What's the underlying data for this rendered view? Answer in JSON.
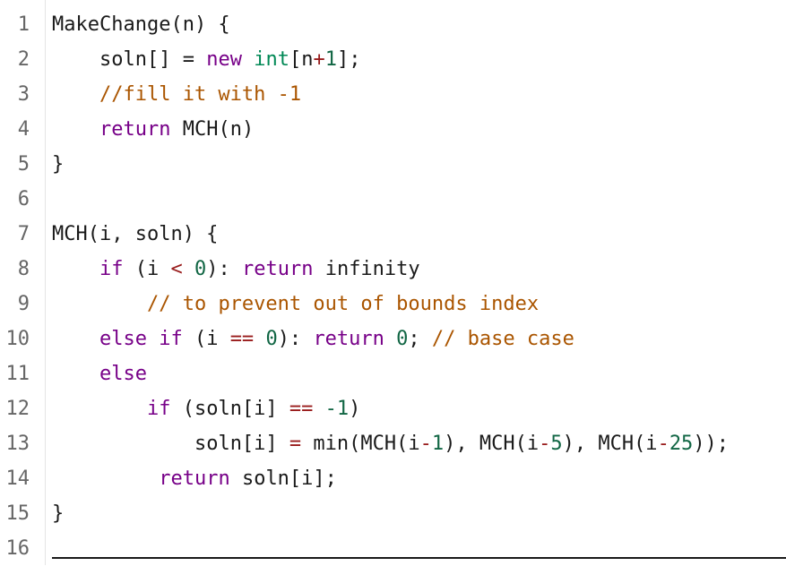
{
  "line_numbers": [
    "1",
    "2",
    "3",
    "4",
    "5",
    "6",
    "7",
    "8",
    "9",
    "10",
    "11",
    "12",
    "13",
    "14",
    "15",
    "16"
  ],
  "code": {
    "l1": {
      "name": "MakeChange(n) {"
    },
    "l2": {
      "a": "soln[] = ",
      "kw": "new",
      "sp": " ",
      "ty": "int",
      "b": "[n",
      "op": "+",
      "n1": "1",
      "c": "];"
    },
    "l3": {
      "cm": "//fill it with -1"
    },
    "l4": {
      "kw": "return",
      "rest": " MCH(n)"
    },
    "l5": {
      "t": "}"
    },
    "l7": {
      "t": "MCH(i, soln) {"
    },
    "l8": {
      "kw1": "if",
      "a": " (i ",
      "op": "<",
      "sp": " ",
      "n0": "0",
      "b": "): ",
      "kw2": "return",
      "c": " infinity"
    },
    "l9": {
      "cm": "// to prevent out of bounds index"
    },
    "l10": {
      "kw1": "else if",
      "a": " (i ",
      "op": "==",
      "sp": " ",
      "n0": "0",
      "b": "): ",
      "kw2": "return",
      "sp2": " ",
      "n1": "0",
      "c": "; ",
      "cm": "// base case"
    },
    "l11": {
      "kw": "else"
    },
    "l12": {
      "kw": "if",
      "a": " (soln[i] ",
      "op": "==",
      "sp": " ",
      "n": "-1",
      "b": ")"
    },
    "l13": {
      "a": "soln[i] ",
      "op1": "=",
      "b": " min(MCH(i",
      "op2": "-",
      "n1": "1",
      "c": "), MCH(i",
      "op3": "-",
      "n2": "5",
      "d": "), MCH(i",
      "op4": "-",
      "n3": "25",
      "e": "));"
    },
    "l14": {
      "kw": "return",
      "rest": " soln[i];"
    },
    "l15": {
      "t": "}"
    }
  },
  "colors": {
    "keyword": "#770088",
    "type": "#008855",
    "number": "#116644",
    "comment": "#aa5500",
    "operator": "#981a1a",
    "text": "#1a1a1a",
    "line_number": "#666666"
  }
}
